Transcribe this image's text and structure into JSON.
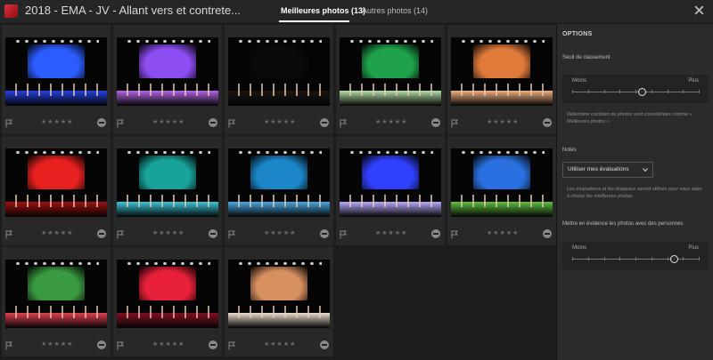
{
  "header": {
    "album_title": "2018 - EMA - JV - Allant vers et contrete...",
    "tabs": [
      {
        "label": "Meilleures photos (13)",
        "active": true
      },
      {
        "label": "Autres photos (14)",
        "active": false
      }
    ]
  },
  "photos": [
    {
      "stars": "★★★★★",
      "backdrop": "#2b5cff",
      "floor": "#2540e0"
    },
    {
      "stars": "★★★★★",
      "backdrop": "#8c4df2",
      "floor": "#b364e8"
    },
    {
      "stars": "★★★★★",
      "backdrop": "#0a0a0a",
      "floor": "#1a1510"
    },
    {
      "stars": "★★★★★",
      "backdrop": "#1fa34a",
      "floor": "#b5e0a8"
    },
    {
      "stars": "★★★★★",
      "backdrop": "#e07a3a",
      "floor": "#f0b080"
    },
    {
      "stars": "★★★★★",
      "backdrop": "#e82020",
      "floor": "#a01010"
    },
    {
      "stars": "★★★★★",
      "backdrop": "#18a39a",
      "floor": "#3bc7d8"
    },
    {
      "stars": "★★★★★",
      "backdrop": "#1a86c8",
      "floor": "#4aa8e0"
    },
    {
      "stars": "★★★★★",
      "backdrop": "#3040ff",
      "floor": "#b8a8ff"
    },
    {
      "stars": "★★★★★",
      "backdrop": "#2a70e0",
      "floor": "#60c040"
    },
    {
      "stars": "★★★★★",
      "backdrop": "#3a9a40",
      "floor": "#e04050"
    },
    {
      "stars": "★★★★★",
      "backdrop": "#e8203a",
      "floor": "#801020"
    },
    {
      "stars": "★★★★★",
      "backdrop": "#d89060",
      "floor": "#ece0d0"
    }
  ],
  "options": {
    "title": "OPTIONS",
    "threshold": {
      "label": "Seuil de classement",
      "min_label": "Moins",
      "max_label": "Plus",
      "value": 0.55,
      "help": "Détermine combien de photos sont considérées comme « Meilleures photos »."
    },
    "notes": {
      "label": "Notes",
      "selected": "Utiliser mes évaluations",
      "help": "Les évaluations et les drapeaux seront utilisés pour vous aider à choisir les meilleures photos."
    },
    "people": {
      "label": "Mettre en évidence les photos avec des personnes",
      "min_label": "Moins",
      "max_label": "Plus",
      "value": 0.8
    }
  }
}
